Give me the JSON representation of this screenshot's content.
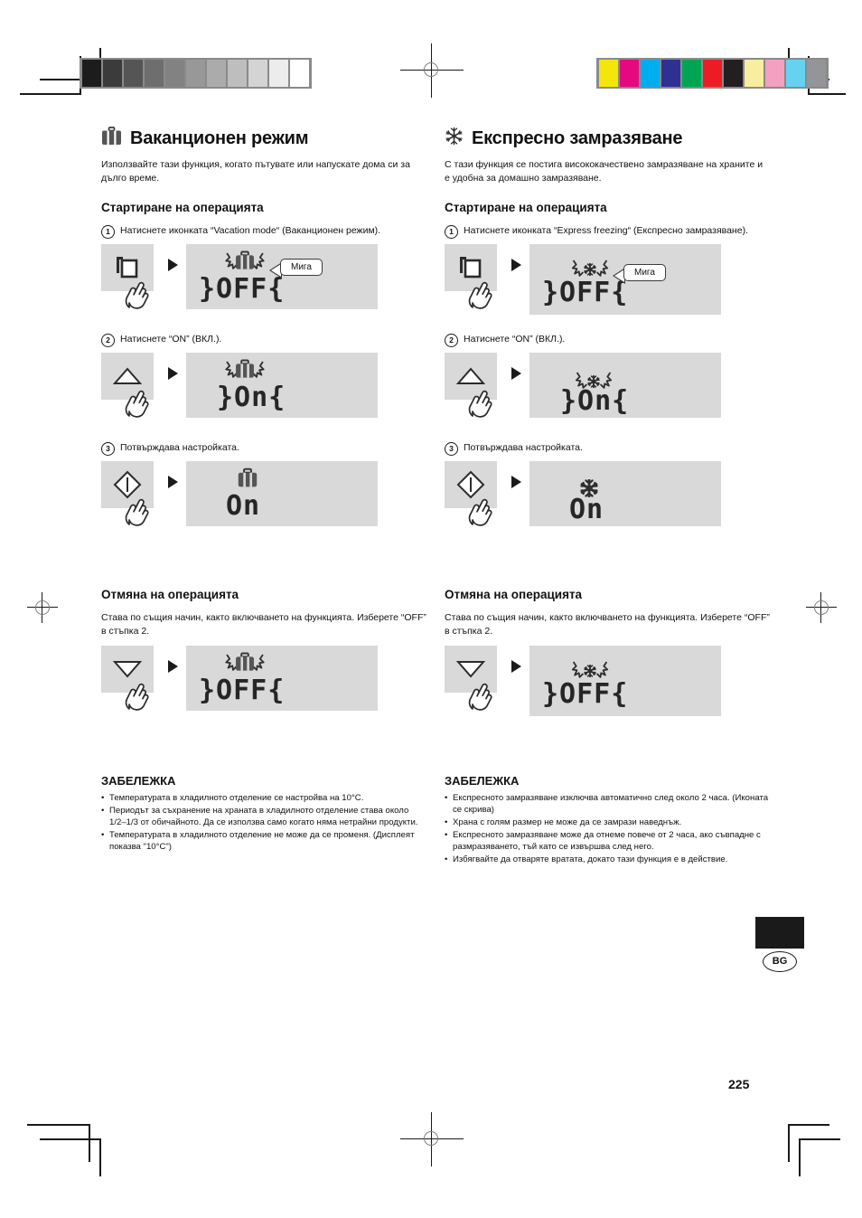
{
  "document": {
    "language_mark": "BG",
    "page_number": "225"
  },
  "printer_marks": {
    "grayscale_steps": [
      "#1c1c1c",
      "#3b3b3b",
      "#555555",
      "#6e6e6e",
      "#828282",
      "#989898",
      "#ababab",
      "#bebebe",
      "#d4d4d4",
      "#ececec",
      "#ffffff"
    ],
    "color_patches": [
      "#f5e60a",
      "#e5097f",
      "#00aeef",
      "#2e3192",
      "#00a551",
      "#ed1c24",
      "#231f20",
      "#f9eda0",
      "#f4a0c0",
      "#66d2f2",
      "#939598"
    ]
  },
  "left_column": {
    "icon": "suitcase-icon",
    "title": "Ваканционен режим",
    "intro": "Използвайте тази функция, когато пътувате или напускате дома си за дълго време.",
    "start_heading": "Стартиране на операцията",
    "steps": [
      {
        "number": "1",
        "text": "Натиснете иконката “Vacation mode“ (Ваканционен режим).",
        "key_icon": "mode-select-key-icon",
        "lcd_icon": "suitcase-icon-blinking",
        "lcd_text": "}OFF{",
        "callout": "Мига"
      },
      {
        "number": "2",
        "text": "Натиснете “ON” (ВКЛ.).",
        "key_icon": "up-triangle-key-icon",
        "lcd_icon": "suitcase-icon-blinking",
        "lcd_text": "}On{",
        "callout": ""
      },
      {
        "number": "3",
        "text": "Потвърждава настройката.",
        "key_icon": "diamond-enter-key-icon",
        "lcd_icon": "suitcase-icon",
        "lcd_text": "On",
        "callout": ""
      }
    ],
    "cancel_heading": "Отмяна на операцията",
    "cancel_text": "Става по същия начин, както включването на функцията. Изберете “OFF” в стъпка 2.",
    "cancel_step": {
      "key_icon": "down-triangle-key-icon",
      "lcd_icon": "suitcase-icon-blinking",
      "lcd_text": "}OFF{"
    },
    "note_heading": "ЗАБЕЛЕЖКА",
    "notes": [
      "Температурата в хладилното отделение се настройва на 10°C.",
      "Периодът за съхранение на храната в хладилното отделение става около 1/2–1/3 от обичайното. Да се използва само когато няма нетрайни продукти.",
      "Температурата в хладилното отделение не може да се променя. (Дисплеят показва \"10°C\")"
    ]
  },
  "right_column": {
    "icon": "snowflake-icon",
    "title": "Експресно замразяване",
    "intro": "С тази функция се постига висококачествено замразяване на храните и е удобна за домашно замразяване.",
    "start_heading": "Стартиране на операцията",
    "steps": [
      {
        "number": "1",
        "text": "Натиснете иконката “Express freezing“ (Експресно замразяване).",
        "key_icon": "mode-select-key-icon",
        "lcd_icon": "snowflake-icon-blinking",
        "lcd_text": "}OFF{",
        "callout": "Мига"
      },
      {
        "number": "2",
        "text": "Натиснете “ON” (ВКЛ.).",
        "key_icon": "up-triangle-key-icon",
        "lcd_icon": "snowflake-icon-blinking",
        "lcd_text": "}On{",
        "callout": ""
      },
      {
        "number": "3",
        "text": "Потвърждава настройката.",
        "key_icon": "diamond-enter-key-icon",
        "lcd_icon": "snowflake-icon",
        "lcd_text": "On",
        "callout": ""
      }
    ],
    "cancel_heading": "Отмяна на операцията",
    "cancel_text": "Става по същия начин, както включването на функцията. Изберете “OFF” в стъпка 2.",
    "cancel_step": {
      "key_icon": "down-triangle-key-icon",
      "lcd_icon": "snowflake-icon-blinking",
      "lcd_text": "}OFF{"
    },
    "note_heading": "ЗАБЕЛЕЖКА",
    "notes": [
      "Експресното замразяване изключва автоматично след около 2 часа. (Иконата се скрива)",
      "Храна с голям размер не може да се замрази наведнъж.",
      "Експресното замразяване може да отнеме повече от 2 часа, ако съвпадне с размразяването, тъй като се извършва след него.",
      "Избягвайте да отваряте вратата, докато тази функция е в действие."
    ]
  }
}
